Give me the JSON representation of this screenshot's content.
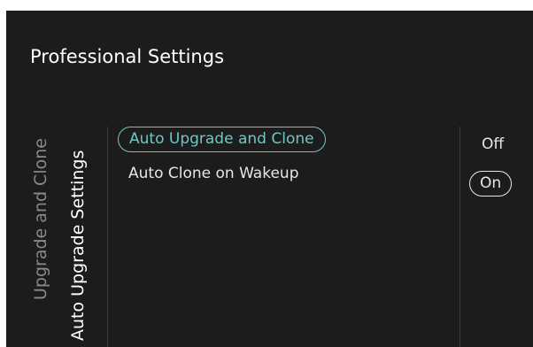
{
  "header": {
    "title": "Professional Settings"
  },
  "sidebar": {
    "tabs": [
      {
        "label": "Upgrade and Clone",
        "active": false
      },
      {
        "label": "Auto Upgrade Settings",
        "active": true
      }
    ]
  },
  "menu": {
    "items": [
      {
        "label": "Auto Upgrade and Clone",
        "selected": true
      },
      {
        "label": "Auto Clone on Wakeup",
        "selected": false
      }
    ]
  },
  "options": {
    "items": [
      {
        "label": "Off",
        "selected": false
      },
      {
        "label": "On",
        "selected": true
      }
    ]
  },
  "colors": {
    "background": "#1c1c1c",
    "accent": "#6ec7c4",
    "text": "#e6e6e6",
    "muted": "#8a8a8a"
  }
}
